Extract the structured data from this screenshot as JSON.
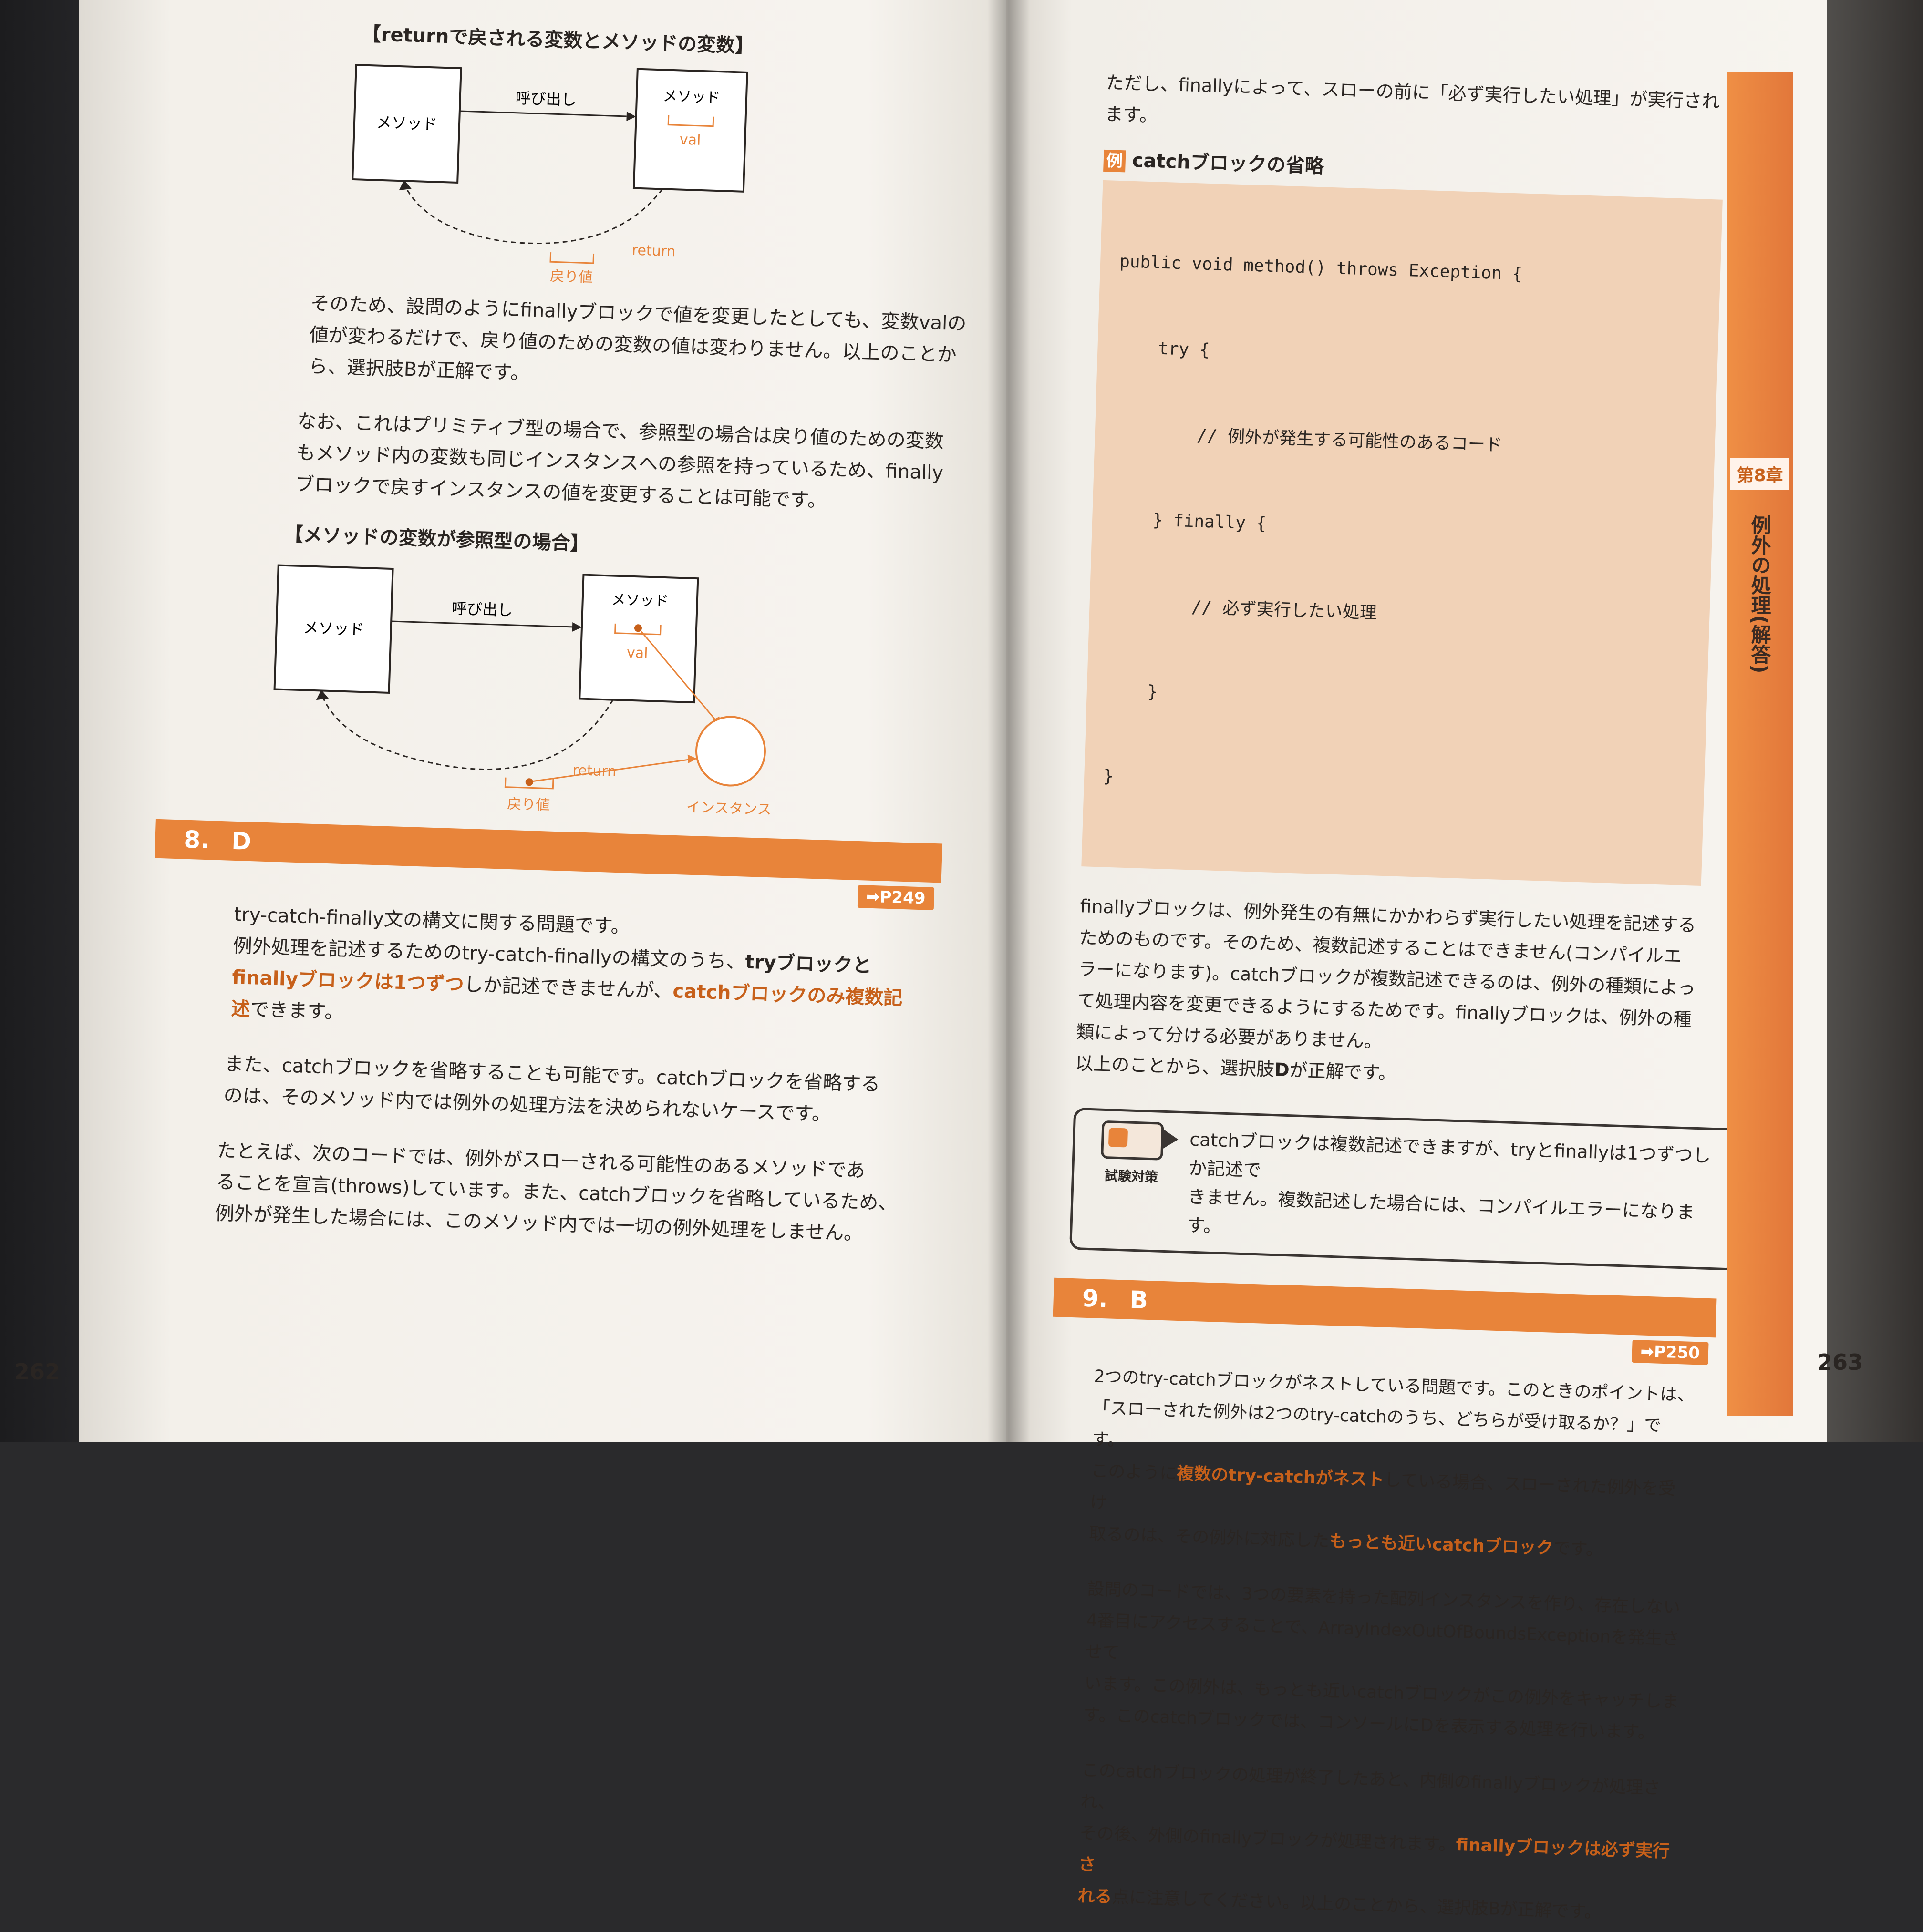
{
  "left_page": {
    "diagram1": {
      "title": "【returnで戻される変数とメソッドの変数】",
      "caller_label": "メソッド",
      "call_label": "呼び出し",
      "callee_label": "メソッド",
      "var_label": "val",
      "return_label": "return",
      "retval_label": "戻り値"
    },
    "para1": [
      "そのため、設問のようにfinallyブロックで値を変更したとしても、変数valの",
      "値が変わるだけで、戻り値のための変数の値は変わりません。以上のことか",
      "ら、選択肢Bが正解です。"
    ],
    "para2": [
      "なお、これはプリミティブ型の場合で、参照型の場合は戻り値のための変数",
      "もメソッド内の変数も同じインスタンスへの参照を持っているため、finally",
      "ブロックで戻すインスタンスの値を変更することは可能です。"
    ],
    "diagram2": {
      "title": "【メソッドの変数が参照型の場合】",
      "caller_label": "メソッド",
      "call_label": "呼び出し",
      "callee_label": "メソッド",
      "var_label": "val",
      "return_label": "return",
      "retval_label": "戻り値",
      "instance_label": "インスタンス"
    },
    "answer": {
      "number": "8.",
      "letter": "D",
      "ref": "➡P249"
    },
    "para3": {
      "l1": "try-catch-finally文の構文に関する問題です。",
      "l2a": "例外処理を記述するためのtry-catch-finallyの構文のうち、",
      "l2b": "tryブロックと",
      "l3a": "finallyブロックは1つずつ",
      "l3b": "しか記述できませんが、",
      "l3c": "catchブロックのみ複数記",
      "l4a": "述",
      "l4b": "できます。"
    },
    "para4": [
      "また、catchブロックを省略することも可能です。catchブロックを省略する",
      "のは、そのメソッド内では例外の処理方法を決められないケースです。"
    ],
    "para5": [
      "たとえば、次のコードでは、例外がスローされる可能性のあるメソッドであ",
      "ることを宣言(throws)しています。また、catchブロックを省略しているため、",
      "例外が発生した場合には、このメソッド内では一切の例外処理をしません。"
    ],
    "page_number": "262"
  },
  "right_page": {
    "intro": "ただし、finallyによって、スローの前に「必ず実行したい処理」が実行されます。",
    "example_badge": "例",
    "example_title": "catchブロックの省略",
    "code": [
      "public void method() throws Exception {",
      "    try {",
      "        // 例外が発生する可能性のあるコード",
      "    } finally {",
      "        // 必ず実行したい処理",
      "    }",
      "}"
    ],
    "para1": {
      "l1": "finallyブロックは、例外発生の有無にかかわらず実行したい処理を記述する",
      "l2": "ためのものです。そのため、複数記述することはできません(コンパイルエ",
      "l3": "ラーになります)。catchブロックが複数記述できるのは、例外の種類によっ",
      "l4": "て処理内容を変更できるようにするためです。finallyブロックは、例外の種",
      "l5": "類によって分ける必要がありません。",
      "l6a": "以上のことから、選択肢",
      "l6b": "D",
      "l6c": "が正解です。"
    },
    "tip": {
      "label": "試験対策",
      "lines": [
        "catchブロックは複数記述できますが、tryとfinallyは1つずつしか記述で",
        "きません。複数記述した場合には、コンパイルエラーになります。"
      ]
    },
    "answer": {
      "number": "9.",
      "letter": "B",
      "ref": "➡P250"
    },
    "para2": {
      "l1": "2つのtry-catchブロックがネストしている問題です。このときのポイントは、",
      "l2": "「スローされた例外は2つのtry-catchのうち、どちらが受け取るか？」です。",
      "l3a": "このように",
      "l3b": "複数のtry-catchがネスト",
      "l3c": "している場合、スローされた例外を受け",
      "l4a": "取るのは、その例外に対応した",
      "l4b": "もっとも近いcatchブロック",
      "l4c": "です。"
    },
    "para3": [
      "設問のコードでは、3つの要素を持った配列インスタンスを作り、存在しない",
      "4番目にアクセスすることで、ArrayIndexOutOfBoundsExceptionを発生させて",
      "います。この例外は、もっとも近いcatchブロックがこの例外をキャッチしま",
      "す。このcatchブロックでは、コンソールにDを表示する処理を行います。"
    ],
    "para4": {
      "l1": "このcatchブロックの処理が終了したあと、内側のfinallyブロックが処理され、",
      "l2a": "その後、外側のfinallyブロックが処理されます。",
      "l2b": "finallyブロックは必ず実行さ",
      "l3a": "れる",
      "l3b": "点に注意してください。以上のことから、選択肢Bが正解です。"
    },
    "side_tab": {
      "chapter": "第8章",
      "title": "例外の処理(解答)"
    },
    "page_number": "263"
  },
  "colors": {
    "accent": "#e8843a",
    "highlight_text": "#c7601a",
    "code_bg": "#f1d2b7"
  }
}
